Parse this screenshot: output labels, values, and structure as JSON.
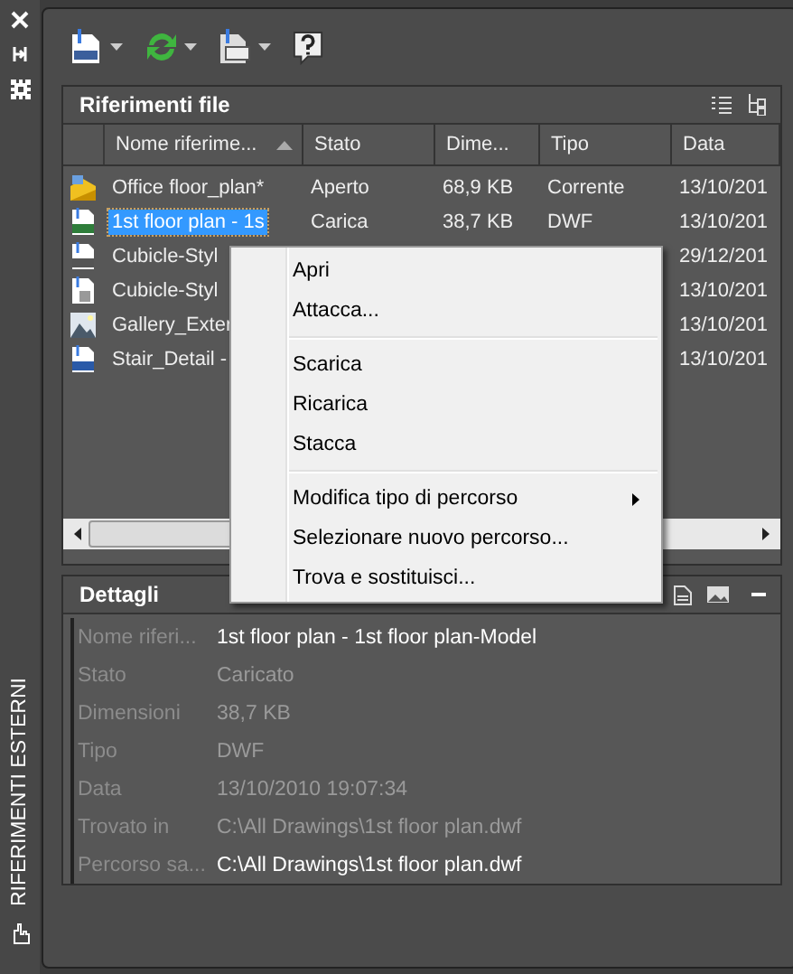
{
  "side_panel": {
    "title": "RIFERIMENTI ESTERNI"
  },
  "file_references": {
    "title": "Riferimenti file",
    "columns": [
      {
        "label": "Nome riferime...",
        "sorted": true
      },
      {
        "label": "Stato",
        "sorted": false
      },
      {
        "label": "Dime...",
        "sorted": false
      },
      {
        "label": "Tipo",
        "sorted": false
      },
      {
        "label": "Data",
        "sorted": false
      }
    ],
    "rows": [
      {
        "kind": "current",
        "selected": false,
        "cells": [
          "Office floor_plan*",
          "Aperto",
          "68,9 KB",
          "Corrente",
          "13/10/201"
        ]
      },
      {
        "kind": "dwf",
        "selected": true,
        "cells": [
          "1st floor plan - 1s",
          "Carica",
          "38,7 KB",
          "DWF",
          "13/10/201"
        ]
      },
      {
        "kind": "dwg",
        "selected": false,
        "cells": [
          "Cubicle-Styl",
          "",
          "",
          "",
          "29/12/201"
        ]
      },
      {
        "kind": "pdf",
        "selected": false,
        "cells": [
          "Cubicle-Styl",
          "",
          "",
          "",
          "13/10/201"
        ]
      },
      {
        "kind": "image",
        "selected": false,
        "cells": [
          "Gallery_Exter",
          "",
          "",
          "",
          "13/10/201"
        ]
      },
      {
        "kind": "dgn",
        "selected": false,
        "cells": [
          "Stair_Detail -",
          "",
          "",
          "",
          "13/10/201"
        ]
      }
    ]
  },
  "context_menu": {
    "items": [
      {
        "kind": "item",
        "label": "Apri"
      },
      {
        "kind": "item",
        "label": "Attacca..."
      },
      {
        "kind": "separator"
      },
      {
        "kind": "item",
        "label": "Scarica"
      },
      {
        "kind": "item",
        "label": "Ricarica"
      },
      {
        "kind": "item",
        "label": "Stacca"
      },
      {
        "kind": "separator"
      },
      {
        "kind": "submenu",
        "label": "Modifica tipo di percorso"
      },
      {
        "kind": "item",
        "label": "Selezionare nuovo percorso..."
      },
      {
        "kind": "item",
        "label": "Trova e sostituisci..."
      }
    ]
  },
  "details": {
    "title": "Dettagli",
    "rows": [
      {
        "label": "Nome riferi...",
        "value": "1st floor plan - 1st floor plan-Model",
        "dimmed": false
      },
      {
        "label": "Stato",
        "value": "Caricato",
        "dimmed": true
      },
      {
        "label": "Dimensioni",
        "value": "38,7 KB",
        "dimmed": true
      },
      {
        "label": "Tipo",
        "value": "DWF",
        "dimmed": true
      },
      {
        "label": "Data",
        "value": "13/10/2010 19:07:34",
        "dimmed": true
      },
      {
        "label": "Trovato in",
        "value": "C:\\All Drawings\\1st floor plan.dwf",
        "dimmed": true
      },
      {
        "label": "Percorso sa...",
        "value": "C:\\All Drawings\\1st floor plan.dwf",
        "dimmed": false
      }
    ]
  }
}
